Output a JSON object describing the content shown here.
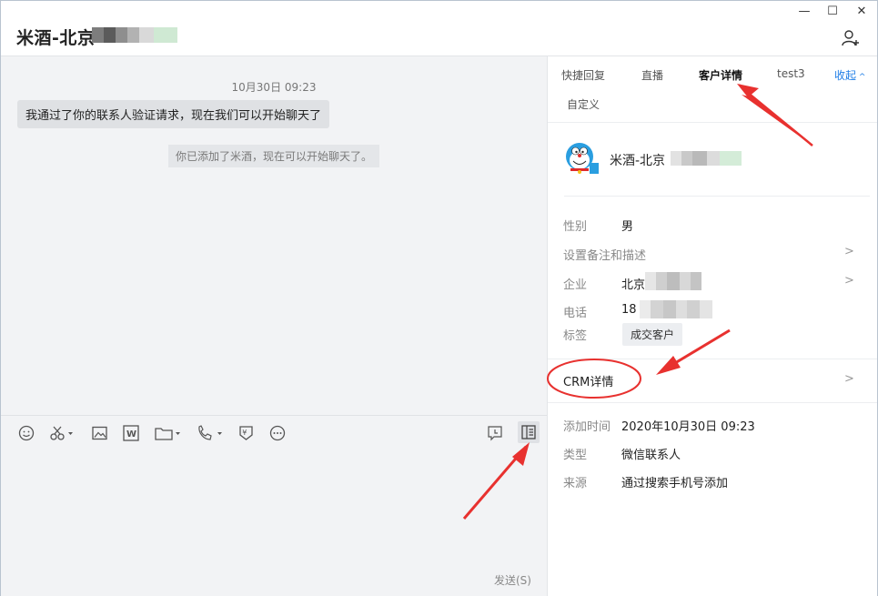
{
  "header": {
    "title": "米酒-北京"
  },
  "window_controls": {
    "minimize": "—",
    "maximize": "☐",
    "close": "✕"
  },
  "chat": {
    "timestamp": "10月30日 09:23",
    "message": "我通过了你的联系人验证请求，现在我们可以开始聊天了",
    "system_notice": "你已添加了米酒，现在可以开始聊天了。"
  },
  "toolbar": {
    "icons": [
      "emoji-icon",
      "scissors-icon",
      "image-icon",
      "word-icon",
      "folder-icon",
      "phone-icon",
      "red-packet-icon",
      "more-icon",
      "chat-history-icon",
      "side-panel-toggle-icon"
    ]
  },
  "composer": {
    "send_label": "发送(S)"
  },
  "panel": {
    "tabs": [
      "快捷回复",
      "直播",
      "客户详情",
      "test3"
    ],
    "collapse_label": "收起",
    "custom_label": "自定义",
    "contact_name": "米酒-北京",
    "fields": {
      "gender_label": "性别",
      "gender_value": "男",
      "remark_label": "设置备注和描述",
      "company_label": "企业",
      "company_value": "北京",
      "phone_label": "电话",
      "phone_value": "18",
      "tag_label": "标签",
      "tag_value": "成交客户"
    },
    "crm_label": "CRM详情",
    "meta": {
      "added_time_label": "添加时间",
      "added_time_value": "2020年10月30日 09:23",
      "type_label": "类型",
      "type_value": "微信联系人",
      "source_label": "来源",
      "source_value": "通过搜索手机号添加"
    }
  },
  "colors": {
    "accent": "#1e7de6",
    "annotation": "#e8312f"
  }
}
